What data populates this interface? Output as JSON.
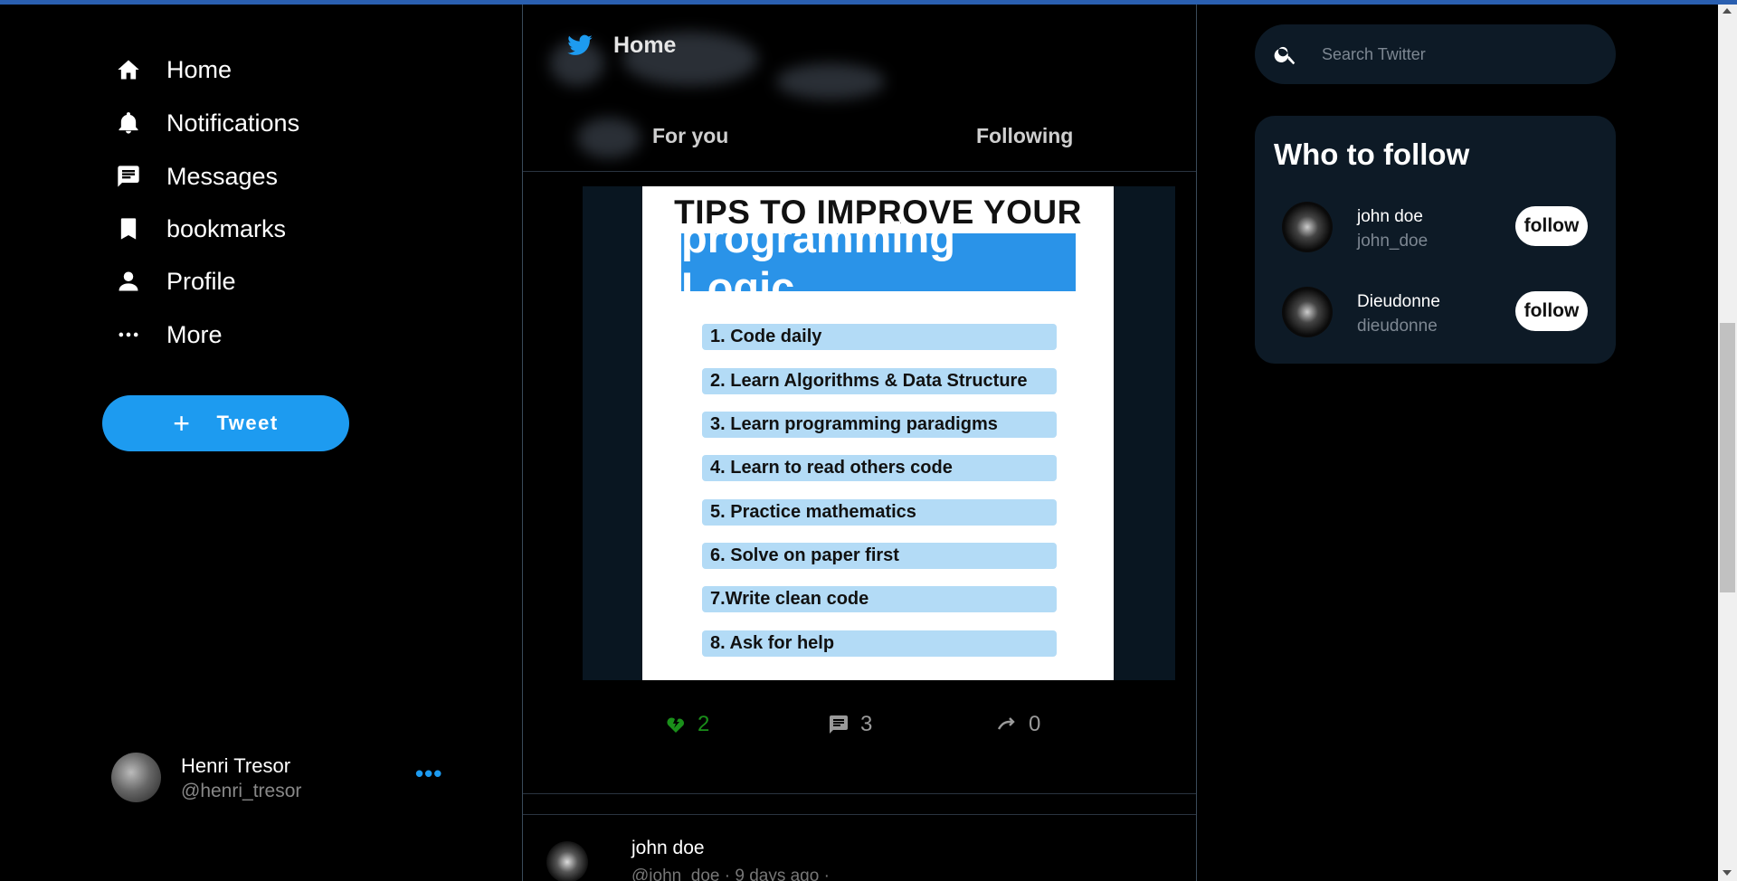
{
  "nav": {
    "items": [
      {
        "label": "Home",
        "icon": "home-icon"
      },
      {
        "label": "Notifications",
        "icon": "bell-icon"
      },
      {
        "label": "Messages",
        "icon": "message-icon"
      },
      {
        "label": "bookmarks",
        "icon": "bookmark-icon"
      },
      {
        "label": "Profile",
        "icon": "person-icon"
      },
      {
        "label": "More",
        "icon": "more-dots-icon"
      }
    ],
    "tweet_label": "Tweet",
    "user": {
      "name": "Henri Tresor",
      "handle": "@henri_tresor"
    }
  },
  "header": {
    "title": "Home",
    "tabs": [
      "For you",
      "Following"
    ]
  },
  "post": {
    "image": {
      "heading": "TIPS TO IMPROVE YOUR",
      "highlight": "programming Logic",
      "tips": [
        "1. Code daily",
        "2. Learn Algorithms & Data Structure",
        "3. Learn programming paradigms",
        "4. Learn to read others code",
        "5. Practice mathematics",
        "6. Solve on paper first",
        "7.Write clean code",
        "8. Ask for help"
      ]
    },
    "likes": "2",
    "comments": "3",
    "retweets": "0"
  },
  "next_post": {
    "name": "john doe",
    "meta": "@john_doe · 9 days ago ·"
  },
  "search": {
    "placeholder": "Search Twitter"
  },
  "who_to_follow": {
    "title": "Who to follow",
    "users": [
      {
        "name": "john doe",
        "handle": "john_doe",
        "button": "follow"
      },
      {
        "name": "Dieudonne",
        "handle": "dieudonne",
        "button": "follow"
      }
    ]
  },
  "colors": {
    "accent": "#1d9bf0",
    "like": "#1a8f1a",
    "panel": "#0d1a26"
  }
}
